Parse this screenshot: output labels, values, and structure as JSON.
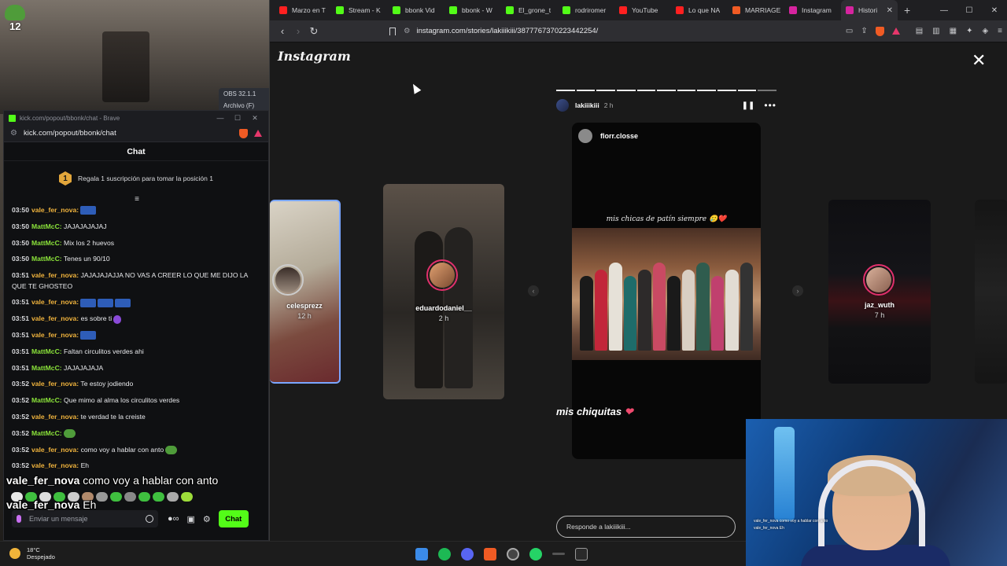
{
  "desktop": {
    "stream_logo_number": "12",
    "obs_label": "OBS 32.1.1",
    "obs_menu": "Archivo (F)"
  },
  "chat_window": {
    "title": "kick.com/popout/bbonk/chat - Brave",
    "url": "kick.com/popout/bbonk/chat",
    "header": "Chat",
    "sub_banner_rank": "1",
    "sub_banner_text": "Regala 1 suscripción para tomar la posición 1",
    "messages": [
      {
        "time": "03:50",
        "user": "vale_fer_nova:",
        "user_color": "#f0b33d",
        "text": "",
        "emote": "blue"
      },
      {
        "time": "03:50",
        "user": "MattMcC:",
        "user_color": "#8be33a",
        "text": "JAJAJAJAJAJ",
        "emote": ""
      },
      {
        "time": "03:50",
        "user": "MattMcC:",
        "user_color": "#8be33a",
        "text": "Mix los 2 huevos",
        "emote": ""
      },
      {
        "time": "03:50",
        "user": "MattMcC:",
        "user_color": "#8be33a",
        "text": "Tenes un 90/10",
        "emote": ""
      },
      {
        "time": "03:51",
        "user": "vale_fer_nova:",
        "user_color": "#f0b33d",
        "text": "JAJAJAJAJJA NO VAS A CREER LO QUE ME DIJO LA QUE TE GHOSTEO",
        "emote": ""
      },
      {
        "time": "03:51",
        "user": "vale_fer_nova:",
        "user_color": "#f0b33d",
        "text": "",
        "emote": "blue3"
      },
      {
        "time": "03:51",
        "user": "vale_fer_nova:",
        "user_color": "#f0b33d",
        "text": "es sobre ti",
        "emote": "purple"
      },
      {
        "time": "03:51",
        "user": "vale_fer_nova:",
        "user_color": "#f0b33d",
        "text": "",
        "emote": "blue"
      },
      {
        "time": "03:51",
        "user": "MattMcC:",
        "user_color": "#8be33a",
        "text": "Faltan circulitos verdes ahi",
        "emote": ""
      },
      {
        "time": "03:51",
        "user": "MattMcC:",
        "user_color": "#8be33a",
        "text": "JAJAJAJAJA",
        "emote": ""
      },
      {
        "time": "03:52",
        "user": "vale_fer_nova:",
        "user_color": "#f0b33d",
        "text": "Te estoy jodiendo",
        "emote": ""
      },
      {
        "time": "03:52",
        "user": "MattMcC:",
        "user_color": "#8be33a",
        "text": "Que mimo al alma los circulitos verdes",
        "emote": ""
      },
      {
        "time": "03:52",
        "user": "vale_fer_nova:",
        "user_color": "#f0b33d",
        "text": "te verdad te la creiste",
        "emote": ""
      },
      {
        "time": "03:52",
        "user": "MattMcC:",
        "user_color": "#8be33a",
        "text": "",
        "emote": "pepe"
      },
      {
        "time": "03:52",
        "user": "vale_fer_nova:",
        "user_color": "#f0b33d",
        "text": "como voy a hablar con anto",
        "emote": "pepe"
      },
      {
        "time": "03:52",
        "user": "vale_fer_nova:",
        "user_color": "#f0b33d",
        "text": "Eh",
        "emote": ""
      }
    ],
    "overlay": [
      {
        "user": "vale_fer_nova",
        "text": " como voy a hablar con anto"
      },
      {
        "user": "vale_fer_nova",
        "text": " Eh"
      }
    ],
    "input_placeholder": "Enviar un mensaje",
    "send_label": "Chat",
    "tool_icons": [
      "people-icon",
      "store-icon",
      "gear-icon"
    ]
  },
  "browser": {
    "tabs": [
      {
        "label": "Marzo en T",
        "icon_color": "#ff2020"
      },
      {
        "label": "Stream - K",
        "icon_color": "#53fc18"
      },
      {
        "label": "bbonk Vid",
        "icon_color": "#53fc18"
      },
      {
        "label": "bbonk - W",
        "icon_color": "#53fc18"
      },
      {
        "label": "El_grone_t",
        "icon_color": "#53fc18"
      },
      {
        "label": "rodriromer",
        "icon_color": "#53fc18"
      },
      {
        "label": "YouTube",
        "icon_color": "#ff2020"
      },
      {
        "label": "Lo que NA",
        "icon_color": "#ff2020"
      },
      {
        "label": "MARRIAGE",
        "icon_color": "#f05b24"
      },
      {
        "label": "Instagram",
        "icon_color": "#d6249f"
      },
      {
        "label": "Histori",
        "icon_color": "#d6249f",
        "active": true
      }
    ],
    "url": "instagram.com/stories/lakiiikiii/3877767370223442254/"
  },
  "instagram": {
    "logo": "Instagram",
    "side_stories": [
      {
        "name": "celesprezz",
        "time": "12 h"
      },
      {
        "name": "eduardodaniel__",
        "time": "2 h"
      },
      {
        "name": "jaz_wuth",
        "time": "7 h"
      }
    ],
    "main_story": {
      "username": "lakiiikiii",
      "time": "2 h",
      "segments_total": 11,
      "segments_done": 10,
      "repost_user": "florr.closse",
      "caption_top": "mis chicas de patín siempre 🥲❤️",
      "caption_bottom": "mis chiquitas",
      "reply_placeholder": "Responde a lakiiikiii..."
    }
  },
  "webcam": {
    "mini_chat": [
      "vale_fer_nova como voy a hablar con anto",
      "vale_fer_nova Eh"
    ]
  },
  "taskbar": {
    "temperature": "18°C",
    "weather": "Despejado"
  }
}
